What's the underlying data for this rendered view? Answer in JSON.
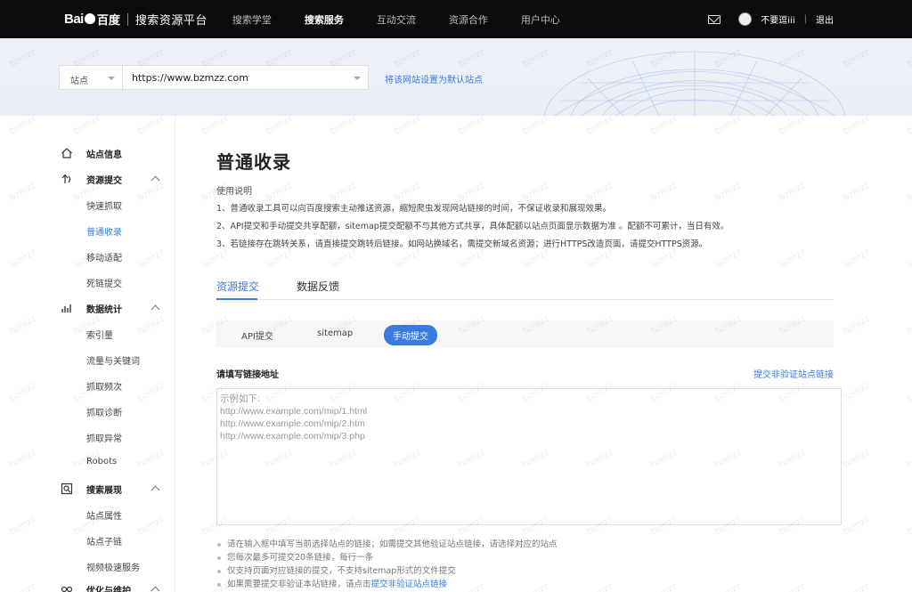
{
  "nav": {
    "logo_text": "Bai",
    "logo_text2": "du",
    "logo_cn": "百度",
    "platform_title": "搜索资源平台",
    "links": [
      {
        "label": "搜索学堂",
        "active": false
      },
      {
        "label": "搜索服务",
        "active": true
      },
      {
        "label": "互动交流",
        "active": false
      },
      {
        "label": "资源合作",
        "active": false
      },
      {
        "label": "用户中心",
        "active": false
      }
    ],
    "username": "不要逗iii",
    "divider": "|",
    "logout": "退出"
  },
  "banner": {
    "site_select_label": "站点",
    "site_url": "https://www.bzmzz.com",
    "default_link": "将该网站设置为默认站点"
  },
  "sidebar": {
    "groups": [
      {
        "title": "站点信息",
        "icon": "home-icon",
        "items": []
      },
      {
        "title": "资源提交",
        "icon": "submit-icon",
        "items": [
          "快速抓取",
          "普通收录",
          "移动适配",
          "死链提交"
        ],
        "active_item": "普通收录"
      },
      {
        "title": "数据统计",
        "icon": "chart-icon",
        "items": [
          "索引量",
          "流量与关键词",
          "抓取频次",
          "抓取诊断",
          "抓取异常",
          "Robots"
        ]
      },
      {
        "title": "搜索展现",
        "icon": "search-display-icon",
        "items": [
          "站点属性",
          "站点子链",
          "视频极速服务"
        ]
      },
      {
        "title": "优化与维护",
        "icon": "optimize-icon",
        "items": []
      }
    ]
  },
  "main": {
    "title": "普通收录",
    "usage_title": "使用说明",
    "usage_lines": [
      "1、普通收录工具可以向百度搜索主动推送资源，缩短爬虫发现网站链接的时间，不保证收录和展现效果。",
      "2、API提交和手动提交共享配额，sitemap提交配额不与其他方式共享，具体配额以站点页面显示数据为准 。配额不可累计，当日有效。",
      "3、若链接存在跳转关系，请直接提交跳转后链接。如网站换域名，需提交新域名资源；进行HTTPS改造页面，请提交HTTPS资源。"
    ],
    "tabs": [
      {
        "label": "资源提交",
        "active": true
      },
      {
        "label": "数据反馈",
        "active": false
      }
    ],
    "subtabs": [
      {
        "label": "API提交",
        "active": false
      },
      {
        "label": "sitemap",
        "active": false
      },
      {
        "label": "手动提交",
        "active": true
      }
    ],
    "field_label": "请填写链接地址",
    "unverified_link": "提交非验证站点链接",
    "textarea_placeholder_lines": [
      "示例如下:",
      "http://www.example.com/mip/1.html",
      "http://www.example.com/mip/2.htm",
      "http://www.example.com/mip/3.php"
    ],
    "notes": [
      "请在输入框中填写当前选择站点的链接；如需提交其他验证站点链接，请选择对应的站点",
      "您每次最多可提交20条链接，每行一条",
      "仅支持页面对应链接的提交，不支持sitemap形式的文件提交"
    ],
    "note_last_prefix": "如果需要提交非验证本站链接，请点击",
    "note_last_link": "提交非验证站点链接"
  },
  "watermark_text": "bzmzz",
  "colors": {
    "accent": "#3a7be0",
    "topnav_bg": "#0c0c0f",
    "banner_bg": "#eef1f8"
  }
}
